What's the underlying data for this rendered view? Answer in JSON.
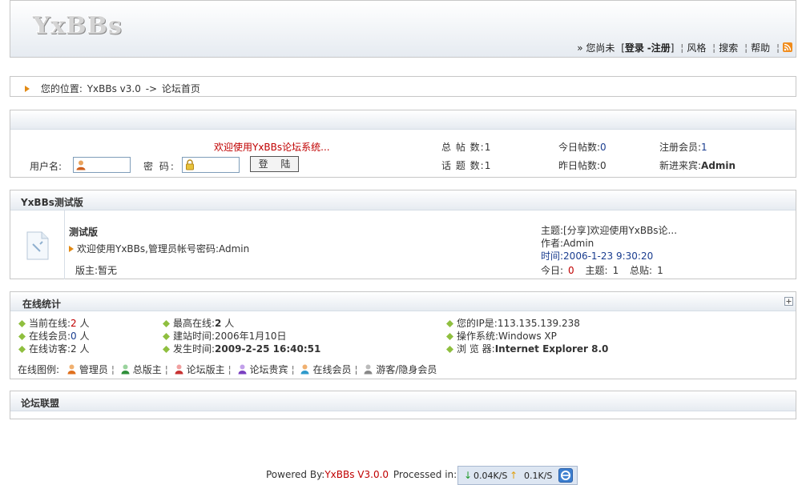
{
  "header": {
    "logo_text": "YxBBs",
    "guest_prefix": "» 您尚未",
    "bracket_open": "[",
    "login": "登录",
    "dash": "-",
    "register": "注册",
    "bracket_close": "]",
    "style_link": "风格",
    "search_link": "搜索",
    "help_link": "帮助"
  },
  "breadcrumb": {
    "prefix": "您的位置:",
    "site_link": "YxBBs v3.0",
    "arrow": "->",
    "current": "论坛首页"
  },
  "login_panel": {
    "welcome": "欢迎使用YxBBs论坛系统...",
    "username_label": "用户名:",
    "password_label": "密 码:",
    "login_button": "登 陆",
    "stats": {
      "total_posts_label": "总 帖 数:",
      "total_posts": "1",
      "topics_label": "话 题 数:",
      "topics": "1",
      "today_posts_label": "今日帖数:",
      "today_posts": "0",
      "yesterday_posts_label": "昨日帖数:",
      "yesterday_posts": "0",
      "members_label": "注册会员:",
      "members": "1",
      "newest_label": "新进来宾:",
      "newest": "Admin"
    }
  },
  "category": {
    "title": "YxBBs测试版",
    "forum_name": "测试版",
    "forum_desc": "欢迎使用YxBBs,管理员帐号密码:Admin",
    "moderator": "版主:暂无",
    "last_topic_label": "主题:",
    "last_topic": "[分享]欢迎使用YxBBs论...",
    "author_label": "作者:",
    "author": "Admin",
    "time_label": "时间:",
    "time": "2006-1-23 9:30:20",
    "today_label": "今日:",
    "today": "0",
    "topics_label": "主题:",
    "topics": "1",
    "posts_label": "总贴:",
    "posts": "1"
  },
  "online": {
    "title": "在线统计",
    "current_online_label": "当前在线:",
    "current_online": "2",
    "online_members_label": "在线会员:",
    "online_members": "0",
    "online_guests_label": "在线访客:",
    "online_guests": "2",
    "unit": "人",
    "max_online_label": "最高在线:",
    "max_online": "2",
    "founded_label": "建站时间:",
    "founded": "2006年1月10日",
    "occurred_label": "发生时间:",
    "occurred": "2009-2-25 16:40:51",
    "ip_label": "您的IP是:",
    "ip": "113.135.139.238",
    "os_label": "操作系统:",
    "os": "Windows XP",
    "browser_label": "浏 览 器:",
    "browser": "Internet Explorer 8.0",
    "legend_label": "在线图例:",
    "legend": [
      "管理员",
      "总版主",
      "论坛版主",
      "论坛贵宾",
      "在线会员",
      "游客/隐身会员"
    ],
    "legend_colors": [
      "#e0701e",
      "#2f8f3a",
      "#c83232",
      "#7a3fc0",
      "#2f9acb",
      "#888888"
    ]
  },
  "alliance": {
    "title": "论坛联盟"
  },
  "footer": {
    "powered_prefix": "Powered By:",
    "powered_link": "YxBBs V3.0.0",
    "processed": "Processed in:0.0"
  },
  "netmeter": {
    "down": "0.04K/S",
    "up": "0.1K/S"
  }
}
